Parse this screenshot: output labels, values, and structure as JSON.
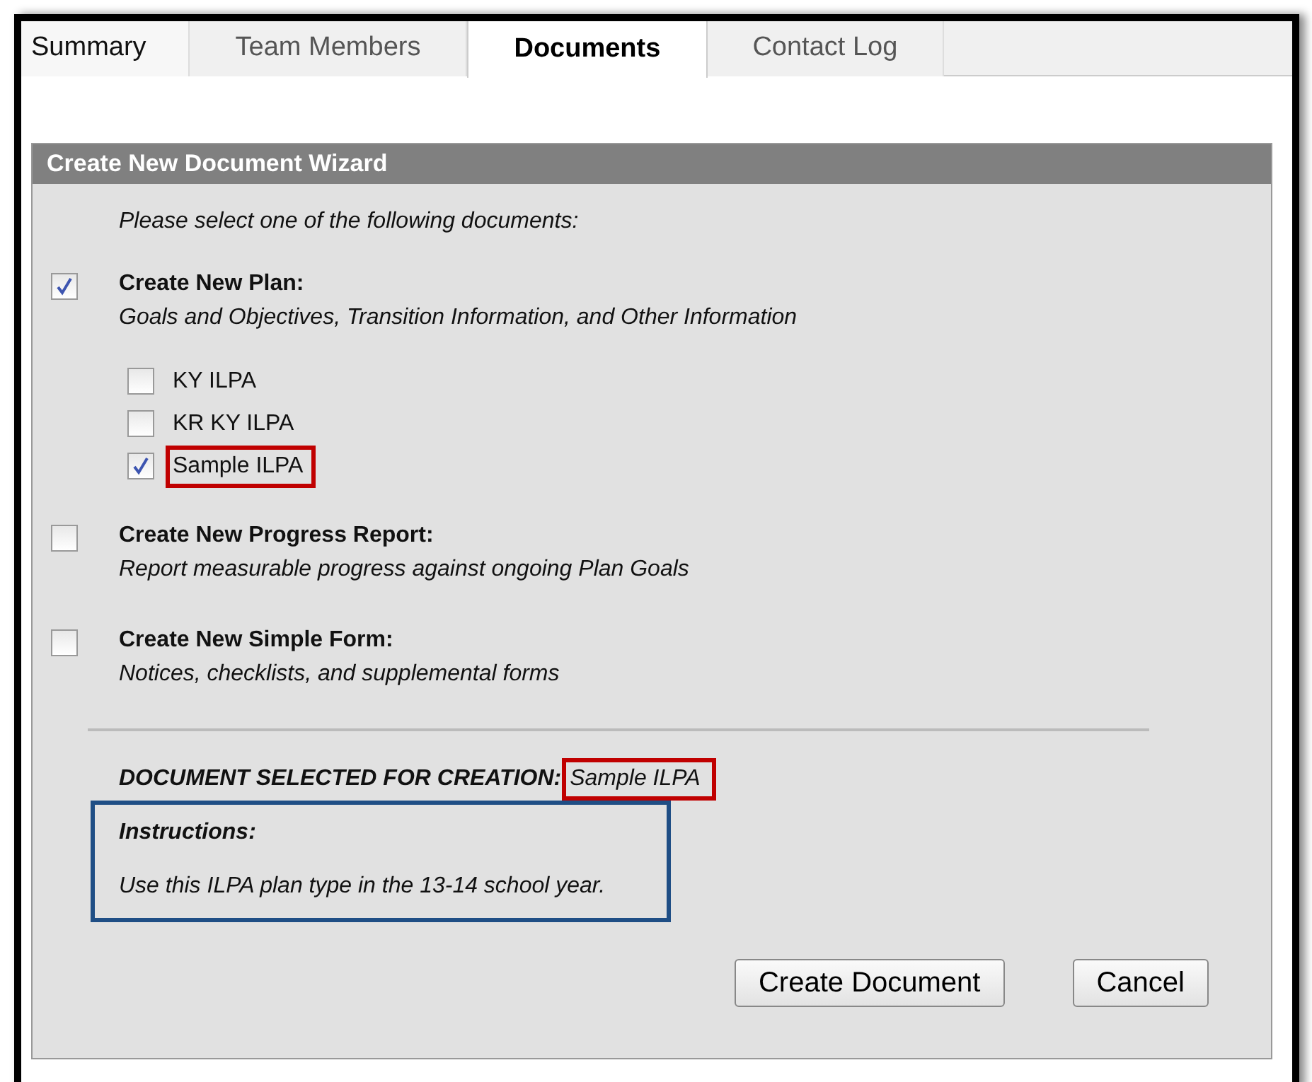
{
  "tabs": [
    {
      "label": "Summary",
      "selected": false
    },
    {
      "label": "Team Members",
      "selected": false
    },
    {
      "label": "Documents",
      "selected": true
    },
    {
      "label": "Contact Log",
      "selected": false
    }
  ],
  "wizard": {
    "title": "Create New Document Wizard",
    "prompt": "Please select one of the following documents:",
    "documents": [
      {
        "title": "Create New Plan:",
        "description": "Goals and Objectives, Transition Information, and Other Information",
        "checked": true,
        "options": [
          {
            "label": "KY ILPA",
            "checked": false,
            "highlighted": false
          },
          {
            "label": "KR KY ILPA",
            "checked": false,
            "highlighted": false
          },
          {
            "label": "Sample ILPA",
            "checked": true,
            "highlighted": true
          }
        ]
      },
      {
        "title": "Create New Progress Report:",
        "description": "Report measurable progress against ongoing Plan Goals",
        "checked": false
      },
      {
        "title": "Create New Simple Form:",
        "description": "Notices, checklists, and supplemental forms",
        "checked": false
      }
    ],
    "selection": {
      "label": "DOCUMENT SELECTED FOR CREATION:",
      "value": "Sample ILPA",
      "highlighted": true
    },
    "instructions": {
      "title": "Instructions:",
      "text": "Use this ILPA plan type in the 13-14 school year.",
      "highlighted": true
    },
    "buttons": [
      "Create Document",
      "Cancel"
    ]
  }
}
